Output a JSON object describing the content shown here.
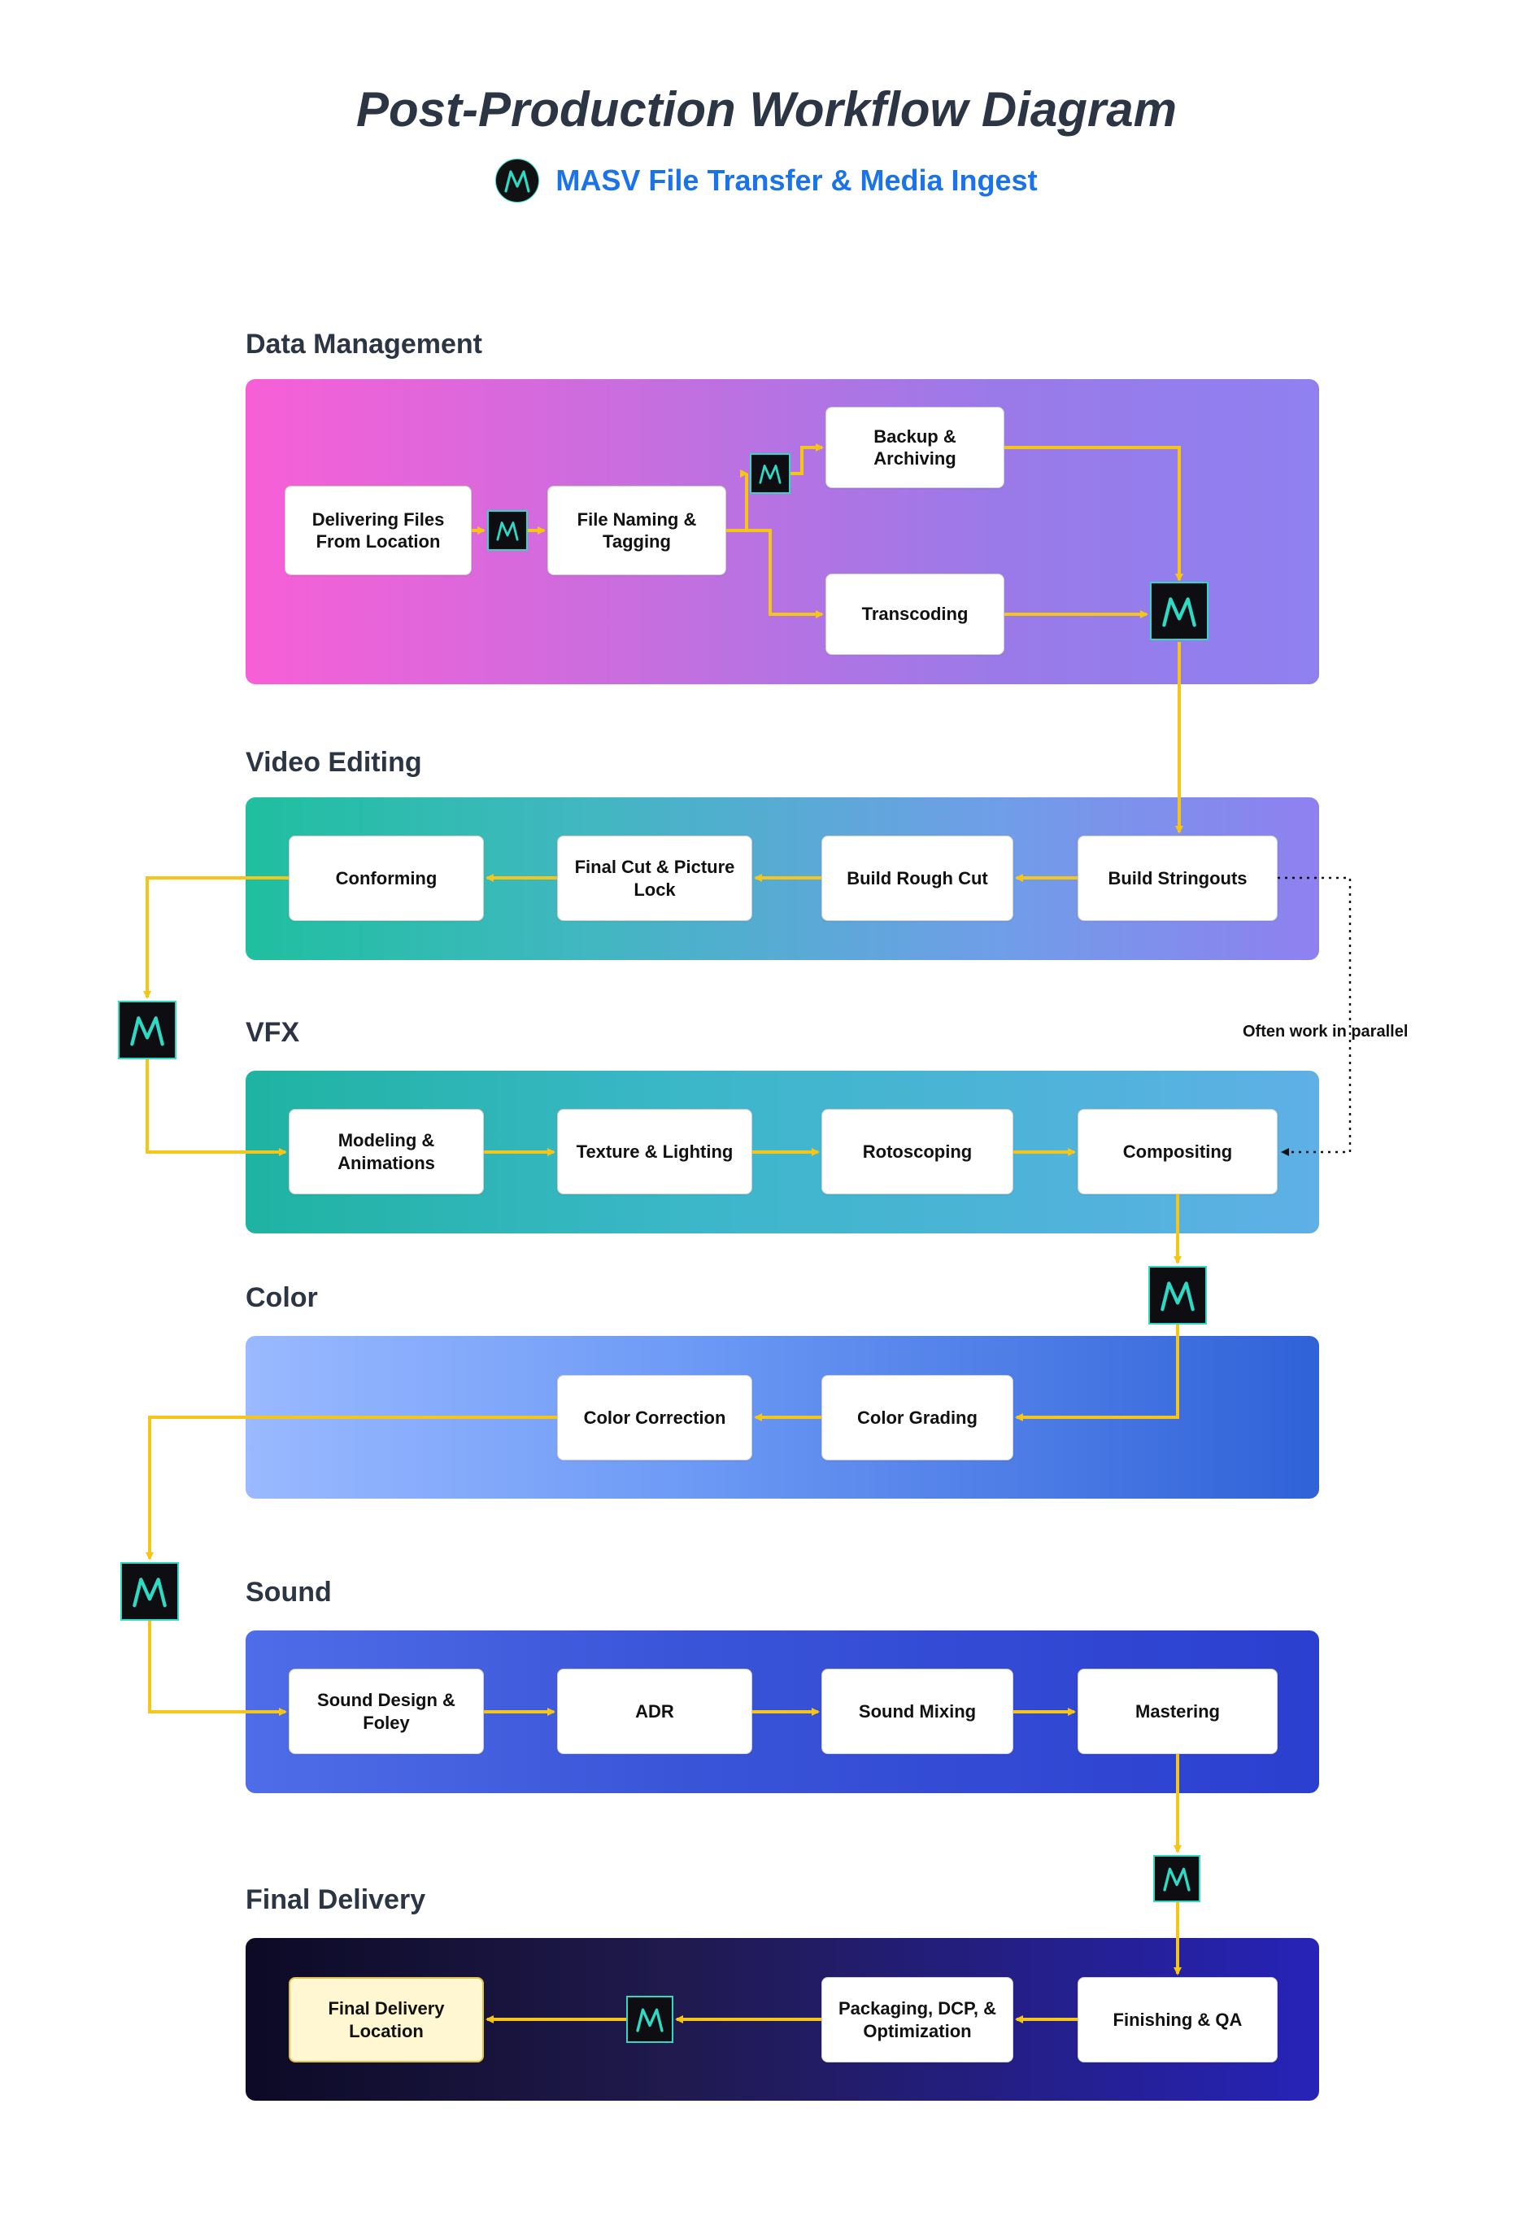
{
  "header": {
    "title": "Post-Production Workflow Diagram",
    "subtitle": "MASV File Transfer & Media Ingest"
  },
  "sections": {
    "data_management": {
      "label": "Data Management"
    },
    "video_editing": {
      "label": "Video Editing"
    },
    "vfx": {
      "label": "VFX"
    },
    "color": {
      "label": "Color"
    },
    "sound": {
      "label": "Sound"
    },
    "final_delivery": {
      "label": "Final Delivery"
    }
  },
  "nodes": {
    "dm_deliver": "Delivering Files From Location",
    "dm_tagging": "File Naming & Tagging",
    "dm_backup": "Backup & Archiving",
    "dm_transcode": "Transcoding",
    "ve_stringouts": "Build Stringouts",
    "ve_rough": "Build Rough Cut",
    "ve_final": "Final Cut & Picture Lock",
    "ve_conform": "Conforming",
    "vfx_model": "Modeling & Animations",
    "vfx_texture": "Texture & Lighting",
    "vfx_roto": "Rotoscoping",
    "vfx_comp": "Compositing",
    "color_grade": "Color Grading",
    "color_correct": "Color Correction",
    "sound_design": "Sound Design & Foley",
    "sound_adr": "ADR",
    "sound_mix": "Sound Mixing",
    "sound_master": "Mastering",
    "fd_finish": "Finishing & QA",
    "fd_package": "Packaging, DCP, & Optimization",
    "fd_location": "Final Delivery Location"
  },
  "annotations": {
    "parallel_note": "Often work in parallel"
  },
  "colors": {
    "arrow": "#f5c518",
    "arrow_dotted": "#111111",
    "logo_accent": "#2fd9c4",
    "subtitle": "#1a73e8"
  }
}
